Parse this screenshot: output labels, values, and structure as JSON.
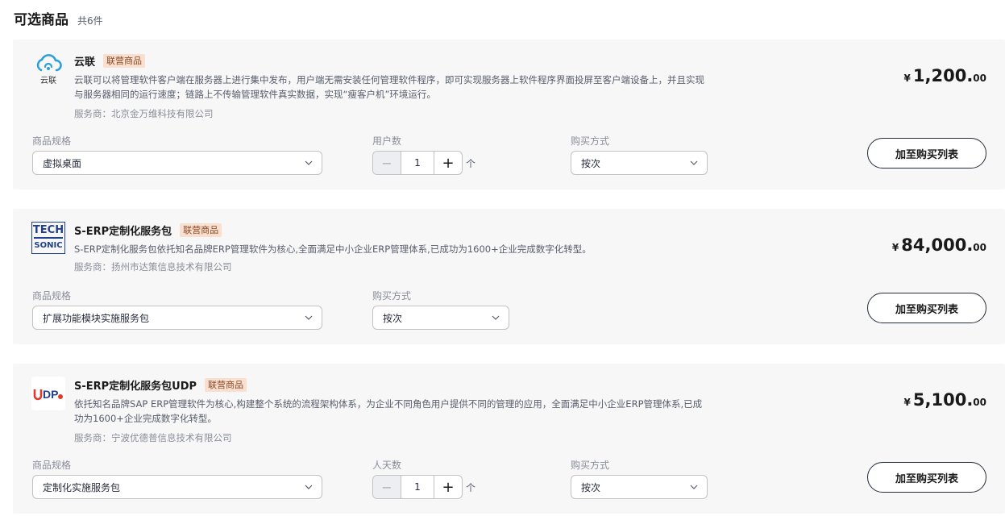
{
  "header": {
    "title": "可选商品",
    "count": "共6件"
  },
  "products": [
    {
      "logo_text": "云联",
      "name": "云联",
      "tag": "联营商品",
      "desc_line1": "云联可以将管理软件客户端在服务器上进行集中发布，用户端无需安装任何管理软件程序，即可实现服务器上软件程序界面投屏至客户端设备上，并且实现",
      "desc_line2": "与服务器相同的运行速度；链路上不传输管理软件真实数据，实现“瘦客户机”环境运行。",
      "vendor": "服务商：北京金万维科技有限公司",
      "price_currency": "¥",
      "price_int": "1,200.",
      "price_dec": "00",
      "spec_label": "商品规格",
      "spec_value": "虚拟桌面",
      "qty_label": "用户数",
      "qty_value": "1",
      "qty_unit": "个",
      "buy_label": "购买方式",
      "buy_value": "按次",
      "add_button": "加至购买列表"
    },
    {
      "logo_text_1": "TECH",
      "logo_text_2": "SONIC",
      "name": "S-ERP定制化服务包",
      "tag": "联营商品",
      "desc_line1": "S-ERP定制化服务包依托知名品牌ERP管理软件为核心,全面满足中小企业ERP管理体系,已成功为1600+企业完成数字化转型。",
      "vendor": "服务商：扬州市达策信息技术有限公司",
      "price_currency": "¥",
      "price_int": "84,000.",
      "price_dec": "00",
      "spec_label": "商品规格",
      "spec_value": "扩展功能模块实施服务包",
      "buy_label": "购买方式",
      "buy_value": "按次",
      "add_button": "加至购买列表"
    },
    {
      "logo_text": "UDP",
      "name": "S-ERP定制化服务包UDP",
      "tag": "联营商品",
      "desc_line1": "依托知名品牌SAP ERP管理软件为核心,构建整个系统的流程架构体系，为企业不同角色用户提供不同的管理的应用，全面满足中小企业ERP管理体系,已成",
      "desc_line2": "功为1600+企业完成数字化转型。",
      "vendor": "服务商：宁波优德普信息技术有限公司",
      "price_currency": "¥",
      "price_int": "5,100.",
      "price_dec": "00",
      "spec_label": "商品规格",
      "spec_value": "定制化实施服务包",
      "qty_label": "人天数",
      "qty_value": "1",
      "qty_unit": "个",
      "buy_label": "购买方式",
      "buy_value": "按次",
      "add_button": "加至购买列表"
    }
  ],
  "colors": {
    "tag_bg": "#f8dfcf",
    "card_bg": "#f7f7f7",
    "logo_blue": "#2a9fd8",
    "logo_red": "#e03a2f"
  },
  "icons": {
    "spec_chevron": "chevron-down-icon",
    "minus": "minus-icon",
    "plus": "plus-icon"
  }
}
